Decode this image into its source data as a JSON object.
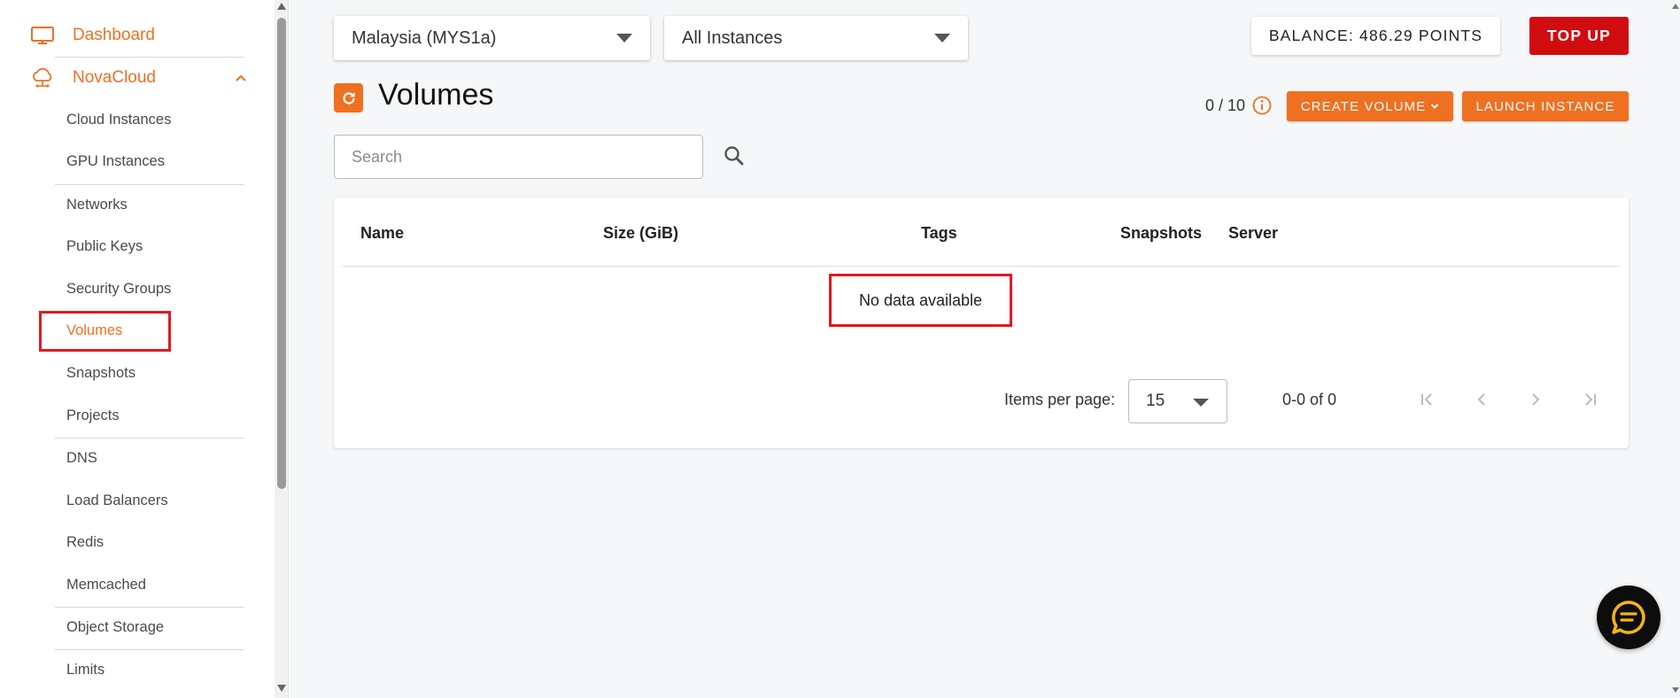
{
  "sidebar": {
    "dashboard_label": "Dashboard",
    "section_label": "NovaCloud",
    "items": [
      {
        "label": "Cloud Instances"
      },
      {
        "label": "GPU Instances"
      },
      {
        "label": "Networks"
      },
      {
        "label": "Public Keys"
      },
      {
        "label": "Security Groups"
      },
      {
        "label": "Volumes"
      },
      {
        "label": "Snapshots"
      },
      {
        "label": "Projects"
      },
      {
        "label": "DNS"
      },
      {
        "label": "Load Balancers"
      },
      {
        "label": "Redis"
      },
      {
        "label": "Memcached"
      },
      {
        "label": "Object Storage"
      },
      {
        "label": "Limits"
      }
    ],
    "active_item": "Volumes"
  },
  "header": {
    "region_selected": "Malaysia (MYS1a)",
    "instance_filter_selected": "All Instances",
    "balance_label": "BALANCE: 486.29 POINTS",
    "topup_label": "TOP UP"
  },
  "page": {
    "title": "Volumes",
    "quota": "0 / 10",
    "create_volume_label": "CREATE VOLUME",
    "launch_instance_label": "LAUNCH INSTANCE",
    "search_placeholder": "Search"
  },
  "table": {
    "columns": [
      "Name",
      "Size (GiB)",
      "Tags",
      "Snapshots",
      "Server"
    ],
    "empty_message": "No data available",
    "items_per_page_label": "Items per page:",
    "items_per_page_value": "15",
    "range_label": "0-0 of 0"
  },
  "colors": {
    "accent": "#f07022",
    "topup": "#d10c11",
    "highlight": "#e2191f",
    "chat_bubble": "#f5b512"
  },
  "icons": {
    "dashboard": "monitor-icon",
    "novacloud": "cloud-network-icon",
    "title": "refresh-icon",
    "info": "info-icon",
    "search": "search-icon",
    "chat": "chat-icon"
  }
}
